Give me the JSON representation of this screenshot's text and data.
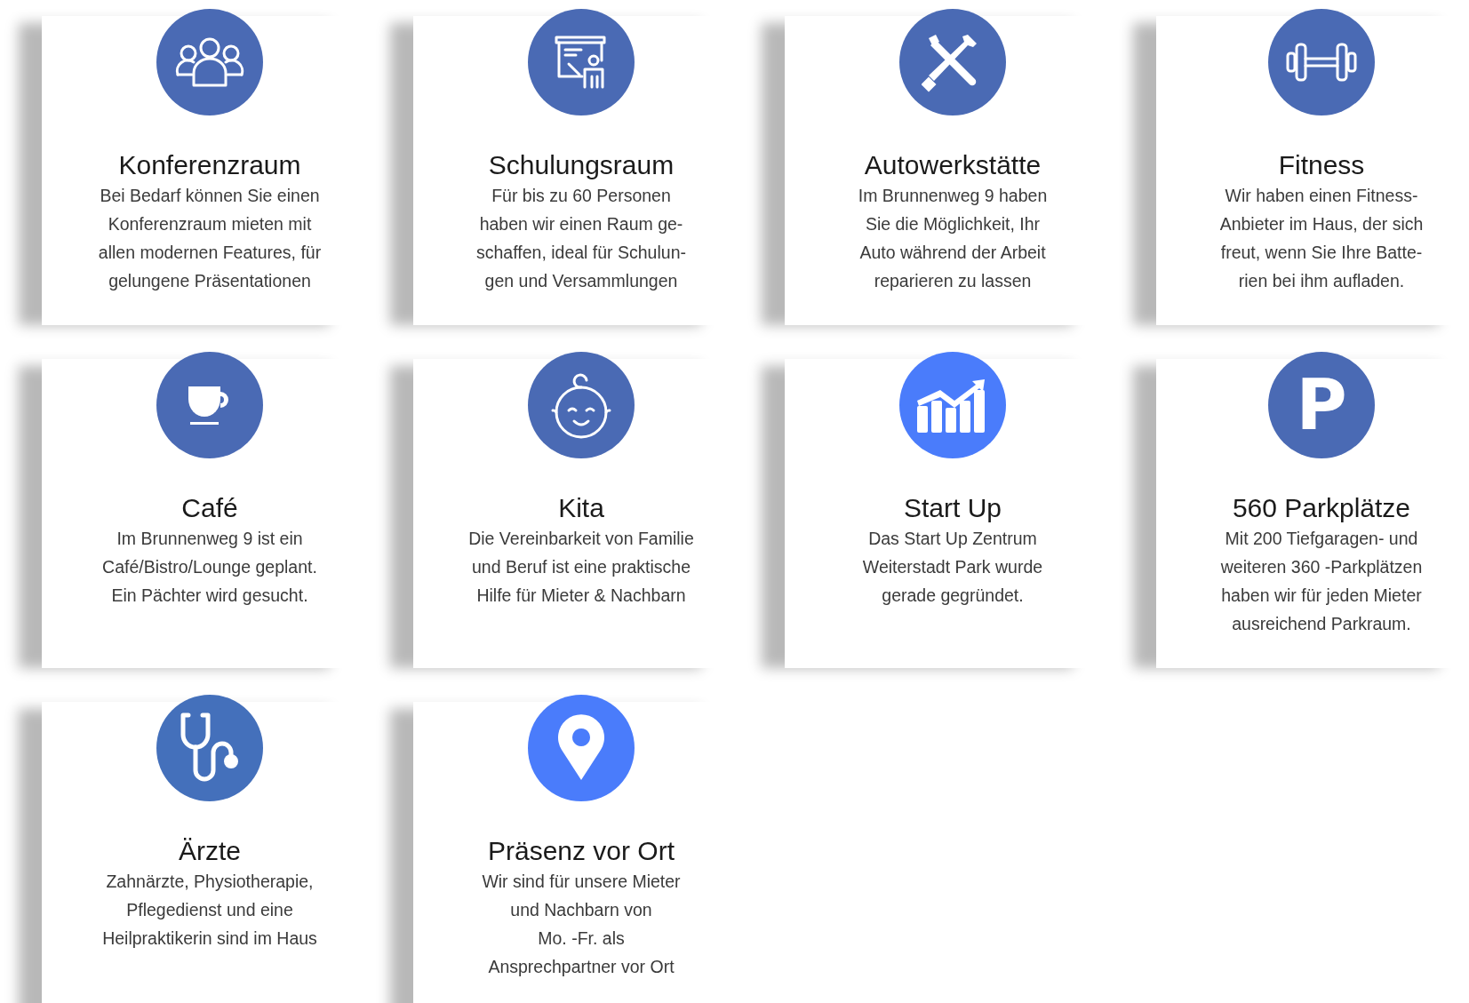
{
  "cards": [
    {
      "color": "#4a6ab4",
      "title": "Konferenzraum",
      "description": "Bei Bedarf können Sie einen\nKonferenzraum mieten mit\nallen modernen Features, für\ngelungene Präsentationen"
    },
    {
      "color": "#4a6ab4",
      "title": "Schulungsraum",
      "description": "Für bis zu 60 Personen\nhaben wir einen Raum ge-\nschaffen, ideal für Schulun-\ngen und Versammlungen"
    },
    {
      "color": "#4a6ab4",
      "title": "Autowerkstätte",
      "description": "Im Brunnenweg 9 haben\nSie die Möglichkeit, Ihr\nAuto während der Arbeit\nreparieren zu lassen"
    },
    {
      "color": "#4a6ab4",
      "title": "Fitness",
      "description": "Wir haben einen Fitness-\nAnbieter im Haus, der sich\nfreut, wenn Sie Ihre Batte-\nrien bei ihm aufladen."
    },
    {
      "color": "#4a6ab4",
      "title": "Café",
      "description": "Im Brunnenweg 9 ist ein\nCafé/Bistro/Lounge geplant.\nEin Pächter wird gesucht."
    },
    {
      "color": "#4a6ab4",
      "title": "Kita",
      "description": "Die Vereinbarkeit von Familie\nund Beruf ist eine praktische\nHilfe für Mieter & Nachbarn"
    },
    {
      "color": "#4a7cfb",
      "title": "Start Up",
      "description": "Das Start Up Zentrum\nWeiterstadt Park wurde\ngerade gegründet."
    },
    {
      "symbol": "P",
      "color": "#4a6ab4",
      "title": "560 Parkplätze",
      "description": "Mit 200 Tiefgaragen- und\nweiteren 360 -Parkplätzen\nhaben wir für jeden Mieter\nausreichend Parkraum."
    },
    {
      "color": "#4470bb",
      "title": "Ärzte",
      "description": "Zahnärzte, Physiotherapie,\nPflegedienst und eine\nHeilpraktikerin sind im Haus"
    },
    {
      "color": "#4a7cfb",
      "title": "Präsenz vor Ort",
      "description": "Wir sind für unsere Mieter\nund Nachbarn von\nMo. -Fr. als\nAnsprechpartner vor Ort"
    }
  ]
}
